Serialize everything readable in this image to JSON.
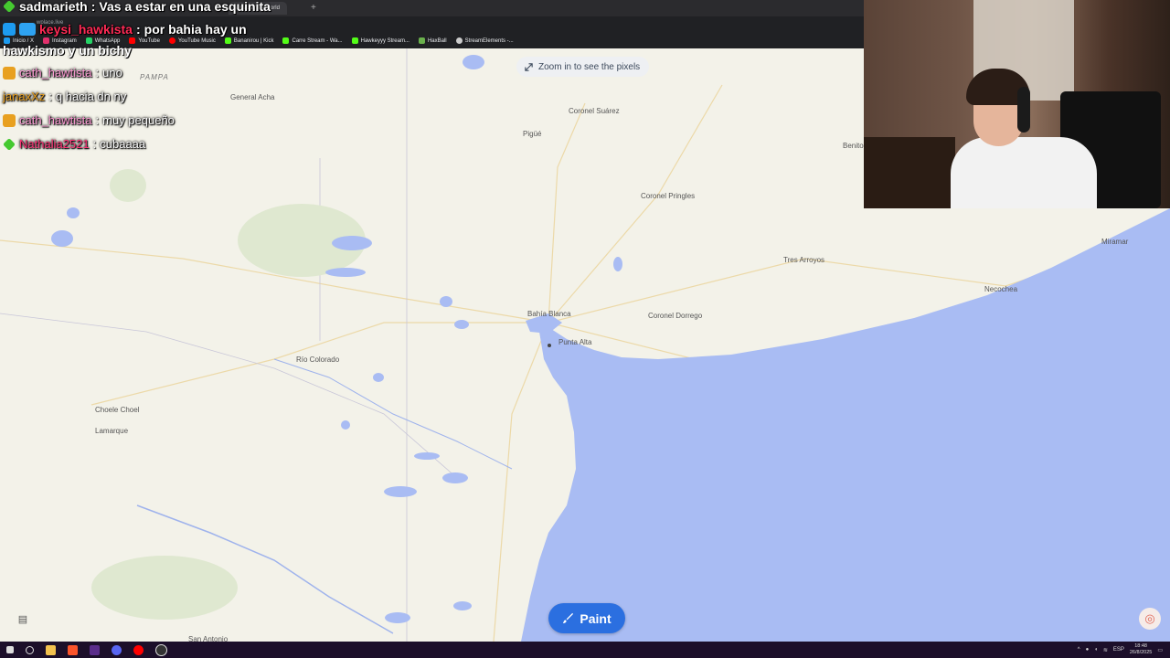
{
  "browser": {
    "tab_title": "wplace | the world",
    "url": "wplace.live",
    "bookmarks": [
      {
        "label": "Inicio / X",
        "color": "#1d9bf0"
      },
      {
        "label": "Instagram",
        "color": "#e1306c"
      },
      {
        "label": "WhatsApp",
        "color": "#25d366"
      },
      {
        "label": "YouTube",
        "color": "#ff0000"
      },
      {
        "label": "YouTube Music",
        "color": "#ff0000"
      },
      {
        "label": "Bananirou | Kick",
        "color": "#53fc18"
      },
      {
        "label": "Carre Stream - Wa...",
        "color": "#53fc18"
      },
      {
        "label": "Hawkeyyy Stream...",
        "color": "#53fc18"
      },
      {
        "label": "HaxBall",
        "color": "#6ab04c"
      },
      {
        "label": "StreamElements -...",
        "color": "#cccccc"
      }
    ]
  },
  "chat": {
    "messages": [
      {
        "user": "sadmarieth",
        "text": "Vas a estar en una esquinita",
        "user_color": "#ffffff",
        "badge_color": "#45c930"
      },
      {
        "user": "keysi_hawkista",
        "text": "por bahia hay un",
        "user_color": "#ff2a55",
        "badge_color": "#1d9bf0"
      },
      {
        "user": "cath_hawtista",
        "text": "uno",
        "user_color": "#ff9ad5",
        "badge_color": "#e8a020"
      },
      {
        "user": "janaxXz",
        "text": "q hacia dn ny",
        "user_color": "#e8a020",
        "badge_color": ""
      },
      {
        "user": "cath_hawtista",
        "text": "muy pequeño",
        "user_color": "#ff9ad5",
        "badge_color": "#e8a020"
      },
      {
        "user": "Nathalia2521",
        "text": "cubaaaa",
        "user_color": "#ff3377",
        "badge_color": "#45c930"
      }
    ],
    "wrapped_text": "hawkismo y un bichy"
  },
  "map": {
    "zoom_hint": "Zoom in to see the pixels",
    "paint_label": "Paint",
    "region_label": "PAMPA",
    "places": {
      "general_acha": "General Acha",
      "pigue": "Pigüé",
      "coronel_suarez": "Coronel Suárez",
      "coronel_pringles": "Coronel Pringles",
      "benito": "Benito",
      "tres_arroyos": "Tres Arroyos",
      "miramar": "Miramar",
      "necochea": "Necochea",
      "bahia_blanca": "Bahía Blanca",
      "punta_alta": "Punta Alta",
      "coronel_dorrego": "Coronel Dorrego",
      "rio_colorado": "Río Colorado",
      "choele_choel": "Choele Choel",
      "lamarque": "Lamarque",
      "san_antonio": "San Antonio"
    },
    "colors": {
      "land": "#f3f2e9",
      "water": "#a9bcf3",
      "accent": "#2b6fe0"
    }
  },
  "taskbar": {
    "time": "18:48",
    "date": "26/8/2025",
    "lang": "ESP"
  }
}
